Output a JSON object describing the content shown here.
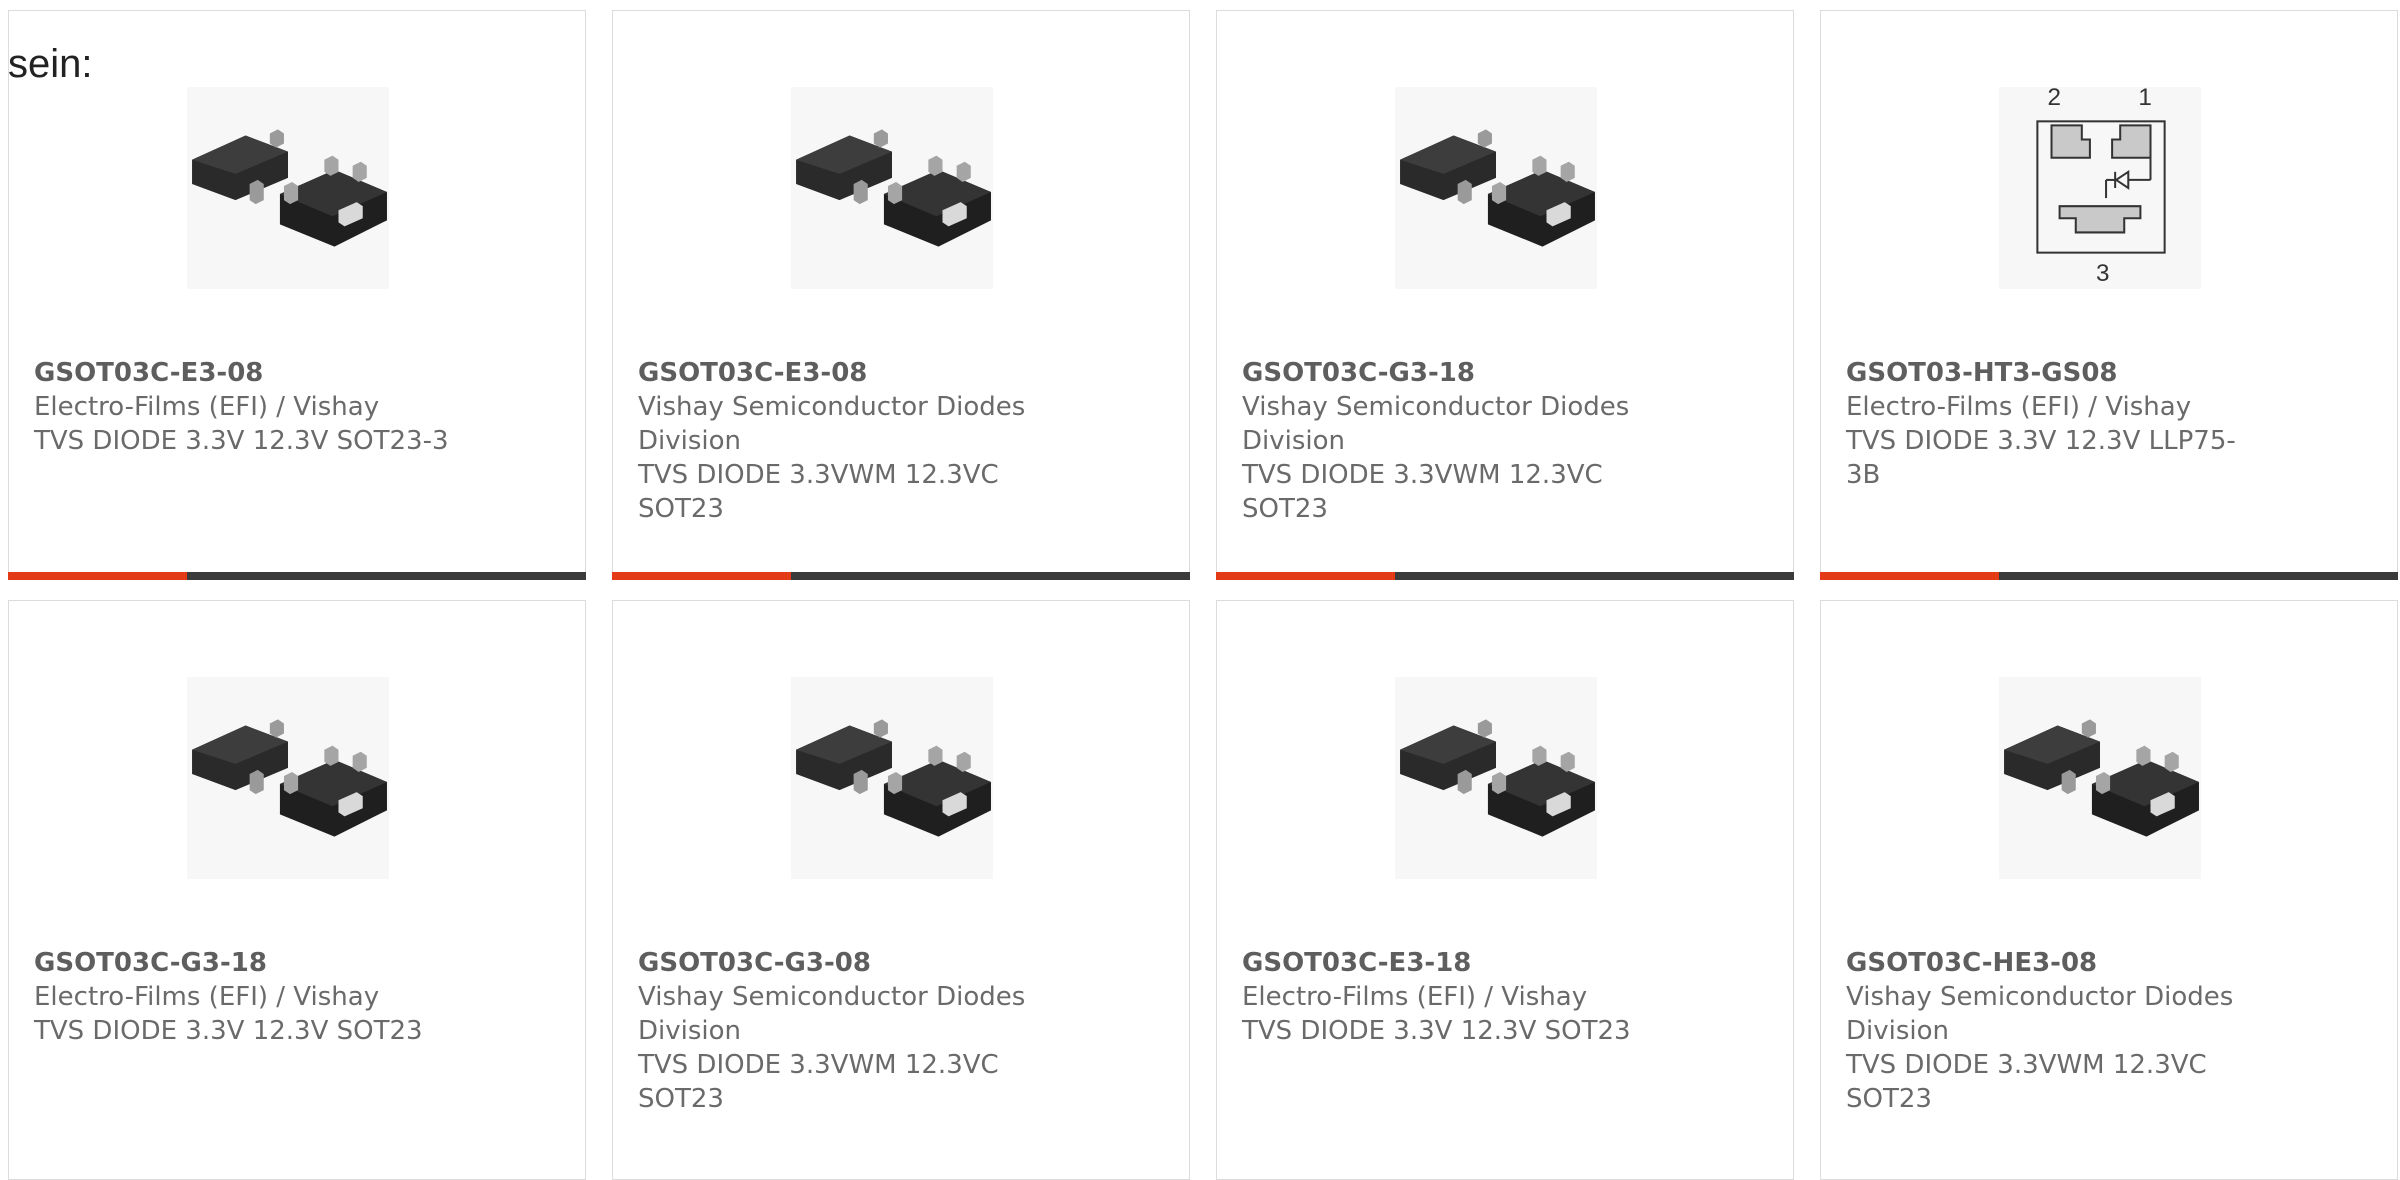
{
  "lead_text": "sein:",
  "accent_color": "#e33b15",
  "bar_color": "#3b3b3b",
  "products": [
    {
      "part_number": "GSOT03C-E3-08",
      "manufacturer": "Electro-Films (EFI) / Vishay",
      "description": "TVS DIODE 3.3V 12.3V SOT23-3",
      "image": "sot23-package-image",
      "progress": 0.31
    },
    {
      "part_number": "GSOT03C-E3-08",
      "manufacturer": "Vishay Semiconductor Diodes Division",
      "description": "TVS DIODE 3.3VWM 12.3VC SOT23",
      "image": "sot23-package-image",
      "progress": 0.31
    },
    {
      "part_number": "GSOT03C-G3-18",
      "manufacturer": "Vishay Semiconductor Diodes Division",
      "description": "TVS DIODE 3.3VWM 12.3VC SOT23",
      "image": "sot23-package-image",
      "progress": 0.31
    },
    {
      "part_number": "GSOT03-HT3-GS08",
      "manufacturer": "Electro-Films (EFI) / Vishay",
      "description": "TVS DIODE 3.3V 12.3V LLP75-3B",
      "image": "llp75-pinout-diagram",
      "pin_labels": [
        "2",
        "1",
        "3"
      ],
      "progress": 0.31
    },
    {
      "part_number": "GSOT03C-G3-18",
      "manufacturer": "Electro-Films (EFI) / Vishay",
      "description": "TVS DIODE 3.3V 12.3V SOT23",
      "image": "sot23-package-image"
    },
    {
      "part_number": "GSOT03C-G3-08",
      "manufacturer": "Vishay Semiconductor Diodes Division",
      "description": "TVS DIODE 3.3VWM 12.3VC SOT23",
      "image": "sot23-package-image"
    },
    {
      "part_number": "GSOT03C-E3-18",
      "manufacturer": "Electro-Films (EFI) / Vishay",
      "description": "TVS DIODE 3.3V 12.3V SOT23",
      "image": "sot23-package-image"
    },
    {
      "part_number": "GSOT03C-HE3-08",
      "manufacturer": "Vishay Semiconductor Diodes Division",
      "description": "TVS DIODE 3.3VWM 12.3VC SOT23",
      "image": "sot23-package-image"
    }
  ]
}
